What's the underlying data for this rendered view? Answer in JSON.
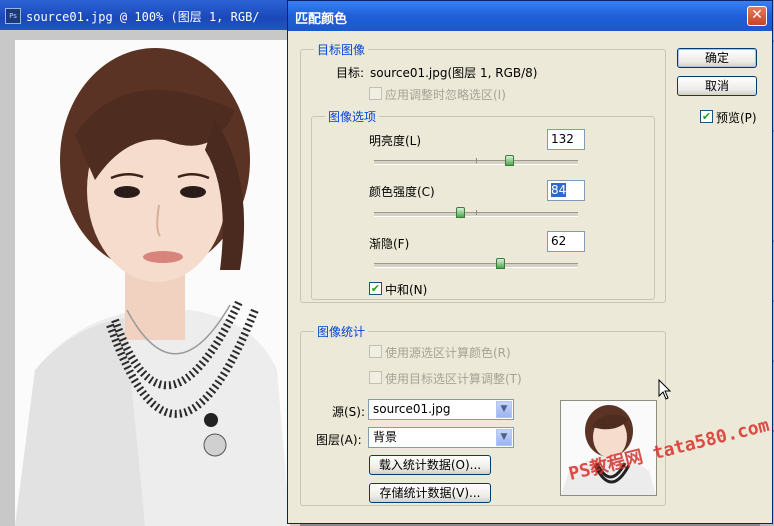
{
  "doc_window": {
    "ps_badge": "Ps",
    "title": "source01.jpg @ 100% (图层 1, RGB/"
  },
  "dialog": {
    "title": "匹配颜色",
    "close_glyph": "✕",
    "ok_label": "确定",
    "cancel_label": "取消",
    "preview_label": "预览(P)",
    "preview_checked": true,
    "target_group": {
      "label": "目标图像",
      "target_prefix": "目标:",
      "target_value": "source01.jpg(图层 1, RGB/8)",
      "ignore_selection_label": "应用调整时忽略选区(I)"
    },
    "options_group": {
      "label": "图像选项",
      "luminance_label": "明亮度(L)",
      "luminance_value": "132",
      "luminance_fraction": 0.66,
      "intensity_label": "颜色强度(C)",
      "intensity_value": "84",
      "intensity_fraction": 0.42,
      "fade_label": "渐隐(F)",
      "fade_value": "62",
      "fade_fraction": 0.62,
      "neutralize_label": "中和(N)",
      "neutralize_checked": true
    },
    "stats_group": {
      "label": "图像统计",
      "use_source_sel_label": "使用源选区计算颜色(R)",
      "use_target_sel_label": "使用目标选区计算调整(T)",
      "source_label": "源(S):",
      "source_value": "source01.jpg",
      "layer_label": "图层(A):",
      "layer_value": "背景",
      "load_stats_label": "载入统计数据(O)...",
      "save_stats_label": "存储统计数据(V)..."
    }
  },
  "watermark": "PS教程网 tata580.com",
  "colors": {
    "titlebar_blue": "#1f5fd8",
    "group_label_blue": "#0046d5",
    "dialog_bg": "#ece9d8",
    "slider_thumb_green": "#4ea84e"
  }
}
